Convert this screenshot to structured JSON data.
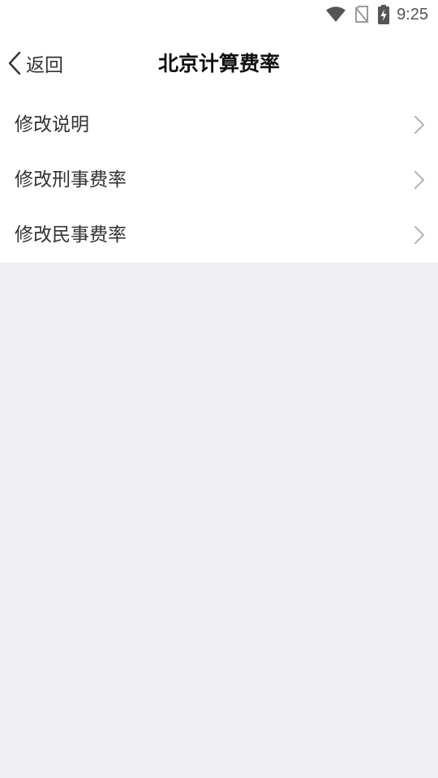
{
  "status_bar": {
    "time": "9:25",
    "icons": [
      "wifi-icon",
      "sim-off-icon",
      "battery-charging-icon"
    ]
  },
  "nav": {
    "back_label": "返回",
    "title": "北京计算费率"
  },
  "menu": {
    "items": [
      {
        "label": "修改说明"
      },
      {
        "label": "修改刑事费率"
      },
      {
        "label": "修改民事费率"
      }
    ]
  },
  "colors": {
    "background": "#efeff4",
    "surface": "#ffffff",
    "text_primary": "#333333",
    "title_text": "#111111",
    "chevron": "#b3b3b3"
  }
}
